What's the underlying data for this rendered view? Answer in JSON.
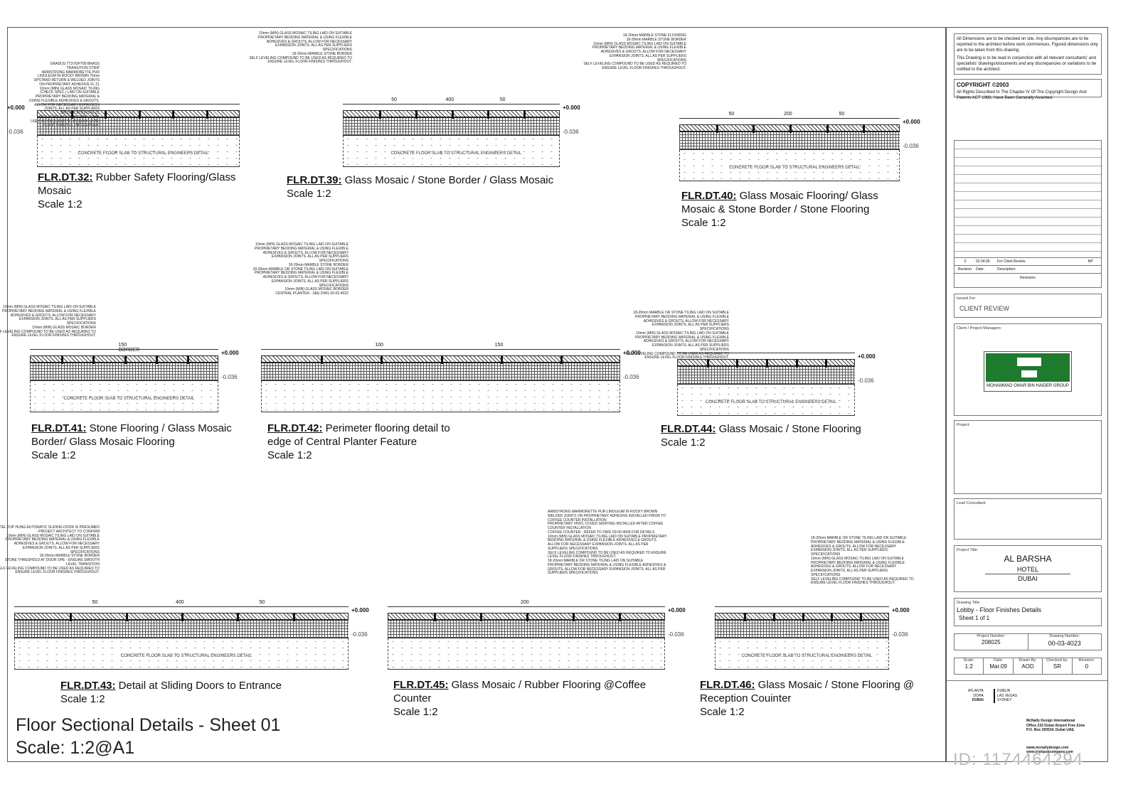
{
  "details": [
    {
      "code": "FLR.DT.32:",
      "title": [
        "Rubber Safety Flooring/Glass",
        "Mosaic"
      ],
      "scale": "Scale 1:2",
      "notes": [
        "GRADUS TT37/DFT80 BRASS TRANSITION STRIP",
        "ARMSTRONG MARMORETTE PUR LINOLEUM IN ROCKY BROWN 75mm UPSTAND RETURN & WELDED JOINTS ON PROPRIETARY ADHESIVE FL.21",
        "10mm (MIN) GLASS MOSAIC TILING (CHECK SPEC.) LAID ON SUITABLE PROPRIETARY BEDDING MATERIAL & USING FLEXIBLE ADHESIVES & GROUTS. ALLOW FOR NECESSARY EXPANSION JOINTS. ALL AS PER SUPPLIERS SPECIFICATIONS FL.01",
        "SELF LEVELING COMPOUND TO BE USED AS REQUIRED TO ENSURE LEVEL FLOOR FINISHES THROUGHOUT."
      ],
      "dims": [],
      "level_top": "+0.000",
      "level_bottom": "-0.036",
      "slab": "CONCRETE FLOOR SLAB TO STRUCTURAL ENGINEERS DETAIL"
    },
    {
      "code": "FLR.DT.39:",
      "title": [
        "Glass Mosaic / Stone Border / Glass Mosaic"
      ],
      "scale": "Scale 1:2",
      "notes": [
        "10mm (MIN) GLASS MOSAIC TILING LAID ON SUITABLE PROPRIETARY BEDDING MATERIAL & USING FLEXIBLE ADHESIVES & GROUTS. ALLOW FOR NECESSARY EXPANSION JOINTS. ALL AS PER SUPPLIERS SPECIFICATIONS",
        "18-20mm MARBLE STONE BORDER",
        "SELF LEVELING COMPOUND TO BE USED AS REQUIRED TO ENSURE LEVEL FLOOR FINISHES THROUGHOUT."
      ],
      "dims": [
        "50",
        "400",
        "50"
      ],
      "level_top": "+0.000",
      "level_bottom": "-0.036",
      "slab": "CONCRETE FLOOR SLAB TO STRUCTURAL ENGINEERS DETAIL"
    },
    {
      "code": "FLR.DT.40:",
      "title": [
        "Glass Mosaic Flooring/ Glass",
        "Mosaic & Stone Border / Stone Flooring"
      ],
      "scale": "Scale 1:2",
      "notes": [
        "18-20mm MARBLE STONE FLOORING",
        "18-20mm MARBLE STONE BORDER",
        "10mm (MIN) GLASS MOSAIC TILING LAID ON SUITABLE PROPRIETARY BEDDING MATERIAL & USING FLEXIBLE ADHESIVES & GROUTS. ALLOW FOR NECESSARY EXPANSION JOINTS. ALL AS PER SUPPLIERS SPECIFICATIONS",
        "SELF LEVELING COMPOUND TO BE USED AS REQUIRED TO ENSURE LEVEL FLOOR FINISHES THROUGHOUT."
      ],
      "dims": [
        "50",
        "200",
        "50"
      ],
      "level_top": "+0.000",
      "level_bottom": "-0.036",
      "slab": "CONCRETE FLOOR SLAB TO STRUCTURAL ENGINEERS DETAIL"
    },
    {
      "code": "FLR.DT.41:",
      "title": [
        "Stone Flooring / Glass Mosaic",
        "Border/ Glass Mosaic Flooring"
      ],
      "scale": "Scale 1:2",
      "notes": [
        "10mm (MIN) GLASS MOSAIC TILING LAID ON SUITABLE PROPRIETARY BEDDING MATERIAL & USING FLEXIBLE ADHESIVES & GROUTS. ALLOW FOR NECESSARY EXPANSION JOINTS. ALL AS PER SUPPLIERS SPECIFICATIONS",
        "10mm (MIN) GLASS MOSAIC BORDER",
        "SELF LEVELING COMPOUND TO BE USED AS REQUIRED TO ENSURE LEVEL FLOOR FINISHES THROUGHOUT."
      ],
      "dims": [
        "150 BORDER"
      ],
      "level_top": "+0.000",
      "level_bottom": "-0.036",
      "slab": "CONCRETE FLOOR SLAB TO STRUCTURAL ENGINEERS DETAIL"
    },
    {
      "code": "FLR.DT.42:",
      "title": [
        "Perimeter flooring detail to",
        "edge of Central Planter Feature"
      ],
      "scale": "Scale 1:2",
      "notes": [
        "10mm (MIN) GLASS MOSAIC TILING LAID ON SUITABLE PROPRIETARY BEDDING MATERIAL & USING FLEXIBLE ADHESIVES & GROUTS. ALLOW FOR NECESSARY EXPANSION JOINTS. ALL AS PER SUPPLIERS SPECIFICATIONS",
        "18-20mm MARBLE STONE BORDER",
        "18-20mm MARBLE OR STONE TILING LAID ON SUITABLE PROPRIETARY BEDDING MATERIAL & USING FLEXIBLE ADHESIVES & GROUTS. ALLOW FOR NECESSARY EXPANSION JOINTS. ALL AS PER SUPPLIERS SPECIFICATIONS",
        "10mm (MIN) GLASS MOSAIC BORDER",
        "CENTRAL PLANTER - SEE DWG 00-02-4022"
      ],
      "dims": [
        "100",
        "150"
      ],
      "level_top": "+0.000",
      "level_bottom": "-0.036",
      "slab": ""
    },
    {
      "code": "FLR.DT.44:",
      "title": [
        "Glass Mosaic / Stone Flooring"
      ],
      "scale": "Scale 1:2",
      "notes": [
        "18-20mm MARBLE OR STONE TILING LAID ON SUITABLE PROPRIETARY BEDDING MATERIAL & USING FLEXIBLE ADHESIVES & GROUTS. ALLOW FOR NECESSARY EXPANSION JOINTS. ALL AS PER SUPPLIERS SPECIFICATIONS",
        "10mm (MIN) GLASS MOSAIC TILING LAID ON SUITABLE PROPRIETARY BEDDING MATERIAL & USING FLEXIBLE ADHESIVES & GROUTS. ALLOW FOR NECESSARY EXPANSION JOINTS. ALL AS PER SUPPLIERS SPECIFICATIONS",
        "SELF LEVELING COMPOUND TO BE USED AS REQUIRED TO ENSURE LEVEL FLOOR FINISHES THROUGHOUT."
      ],
      "dims": [],
      "level_top": "+0.000",
      "level_bottom": "-0.036",
      "slab": "CONCRETE FLOOR SLAB TO STRUCTURAL ENGINEERS DETAIL"
    },
    {
      "code": "FLR.DT.43:",
      "title": [
        "Detail at Sliding Doors to Entrance"
      ],
      "scale": "Scale 1:2",
      "notes": [
        "KOTEL TOP HUNG AUTOMATIC SLIDING DOOR IS PRESUMED - PROJECT ARCHITECT TO CONFIRM",
        "10mm (MIN) GLASS MOSAIC TILING LAID ON SUITABLE PROPRIETARY BEDDING MATERIAL & USING FLEXIBLE ADHESIVES & GROUTS. ALLOW FOR NECESSARY EXPANSION JOINTS. ALL AS PER SUPPLIERS SPECIFICATIONS",
        "18-20mm MARBLE STONE BORDER",
        "STONE THRESHOLD AT DOOR OPE - ENSURE SMOOTH LEVEL TRANSITION",
        "SELF LEVELING COMPOUND TO BE USED AS REQUIRED TO ENSURE LEVEL FLOOR FINISHES THROUGHOUT."
      ],
      "dims": [
        "50",
        "400",
        "50"
      ],
      "level_top": "+0.000",
      "level_bottom": "-0.036",
      "slab": "CONCRETE FLOOR SLAB TO STRUCTURAL ENGINEERS DETAIL"
    },
    {
      "code": "FLR.DT.45:",
      "title": [
        "Glass Mosaic / Rubber Flooring @Coffee",
        "Counter"
      ],
      "scale": "Scale 1:2",
      "notes": [
        "ARMSTRONG MARMORETTE PUR LINOLEUM IN ROCKY BROWN WELDED JOINTS ON PROPRIETARY ADHESIVE INSTALLED PRIOR TO COFFEE COUNTER INSTALLATION",
        "PROPRIETARY VINYL COVED SKIRTING INSTALLED AFTER COFFEE COUNTER INSTALLATION",
        "COFFEE COUNTER - REFER TO DWG 00-00-4009 FOR DETAILS",
        "10mm (MIN) GLASS MOSAIC TILING LAID ON SUITABLE PROPRIETARY BEDDING MATERIAL & USING FLEXIBLE ADHESIVES & GROUTS. ALLOW FOR NECESSARY EXPANSION JOINTS. ALL AS PER SUPPLIERS SPECIFICATIONS",
        "SELF LEVELING COMPOUND TO BE USED AS REQUIRED TO ENSURE LEVEL FLOOR FINISHES THROUGHOUT.",
        "18-20mm MARBLE OR STONE TILING LAID ON SUITABLE PROPRIETARY BEDDING MATERIAL & USING FLEXIBLE ADHESIVES & GROUTS. ALLOW FOR NECESSARY EXPANSION JOINTS. ALL AS PER SUPPLIERS SPECIFICATIONS"
      ],
      "dims": [
        "200"
      ],
      "level_top": "+0.000",
      "level_bottom": "-0.036",
      "slab": ""
    },
    {
      "code": "FLR.DT.46:",
      "title": [
        "Glass Mosaic / Stone Flooring @",
        "Reception Couinter"
      ],
      "scale": "Scale 1:2",
      "notes": [
        "18-20mm MARBLE OR STONE TILING LAID ON SUITABLE PROPRIETARY BEDDING MATERIAL & USING FLEXIBLE ADHESIVES & GROUTS. ALLOW FOR NECESSARY EXPANSION JOINTS. ALL AS PER SUPPLIERS SPECIFICATIONS",
        "10mm (MIN) GLASS MOSAIC TILING LAID ON SUITABLE PROPRIETARY BEDDING MATERIAL & USING FLEXIBLE ADHESIVES & GROUTS. ALLOW FOR NECESSARY EXPANSION JOINTS. ALL AS PER SUPPLIERS SPECIFICATIONS",
        "SELF LEVELING COMPOUND TO BE USED AS REQUIRED TO ENSURE LEVEL FLOOR FINISHES THROUGHOUT."
      ],
      "dims": [],
      "level_top": "+0.000",
      "level_bottom": "-0.036",
      "slab": "CONCRETE FLOOR SLAB TO STRUCTURAL ENGINEERS DETAIL"
    }
  ],
  "sheet": {
    "title": "Floor Sectional Details - Sheet 01",
    "scale": "Scale: 1:2@A1"
  },
  "titleblock": {
    "note1": "All Dimensions are to be checked on site. Any discrepancies are to be reported to the architect before work commences. Figured dimensions only are to be taken from this drawing.",
    "note2": "This Drawing is to be read in conjunction with all relevant consultants' and specialists' drawings/documents and any discrepancies or variations to be notified to the architect.",
    "copyright": "COPYRIGHT ©2003",
    "copyright_text": "All Rights Described In The Chapter IV Of The Copyright Design And Patents ACT 1988, Have Been Generally Asserted.",
    "revision_row": {
      "rev": "0",
      "date": "02.04.09",
      "desc": "For Client Review",
      "by": "BP"
    },
    "revision_headers": {
      "rev": "Revision:",
      "date": "Date:",
      "desc": "Description:",
      "caption": "Revisions"
    },
    "issued_for_label": "Issued For:",
    "issued_for": "CLIENT REVIEW",
    "client_label": "Client / Project Managers:",
    "client_logo_text": "MOHAMMAD OMAR BIN HAIDER GROUP",
    "client_color": "#1e7a2e",
    "project_label": "Project:",
    "consultant_label": "Lead Consultant:",
    "project_title_label": "Project Title:",
    "project_title": [
      "AL BARSHA",
      "HOTEL",
      "DUBAI"
    ],
    "drawing_title_label": "Drawing Title:",
    "drawing_title": "Lobby - Floor Finishes Details",
    "sheet_of": "Sheet 1 of 1",
    "project_number_label": "Project Number:",
    "project_number": "208025",
    "drawing_number_label": "Drawing Number:",
    "drawing_number": "00-03-4023",
    "scale_label": "Scale:",
    "scale": "1:2",
    "date_label": "Date:",
    "date": "Mar.09",
    "drawn_label": "Drawn By:",
    "drawn": "AOD",
    "checked_label": "Checked by:",
    "checked": "SR",
    "revision_label": "Revision:",
    "revision": "0",
    "cities_left": [
      "ATLANTA",
      "DOHA",
      "DUBAI"
    ],
    "cities_right": [
      "DUBLIN",
      "LAS VEGAS",
      "SYDNEY"
    ],
    "office": [
      "McNally Design International",
      "Office 232 Dubai Airport Free Zone",
      "P.O. Box 293534, Dubai UAE."
    ],
    "web": [
      "www.mcnallydesign.com",
      "www.irishpubcompany.com"
    ]
  },
  "watermark": "ID: 1174464294"
}
